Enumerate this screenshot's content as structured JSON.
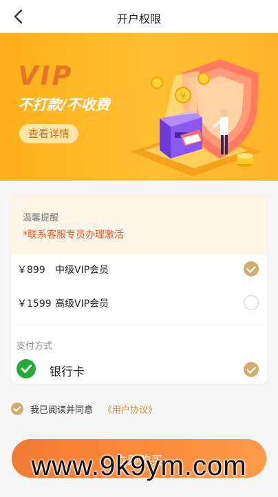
{
  "header": {
    "title": "开户权限",
    "back_icon": "chevron-left-icon"
  },
  "banner": {
    "vip_text": "VIP",
    "slogan": "不打款/不收费",
    "detail_button": "查看详情",
    "colors": {
      "background": "#ffb620",
      "vip": "#e8732a",
      "shield": "#ff6f5b"
    }
  },
  "notice": {
    "title": "温馨提醒",
    "text": "*联系客服专员办理激活"
  },
  "plans": [
    {
      "price": "￥899",
      "name": "中级VIP会员",
      "selected": true
    },
    {
      "price": "￥1599",
      "name": "高级VIP会员",
      "selected": false
    }
  ],
  "payment": {
    "title": "支付方式",
    "method": "银行卡",
    "icon": "check-circle-icon",
    "selected": true
  },
  "agreement": {
    "text": "我已阅读并同意",
    "link": "《用户协议》",
    "checked": true
  },
  "buy_button": {
    "label": "立即购买"
  },
  "watermark": "www.9k9ym.com",
  "colors": {
    "accent": "#d1ad6e",
    "warning": "#e15a2a",
    "button": "#f98a3a"
  }
}
